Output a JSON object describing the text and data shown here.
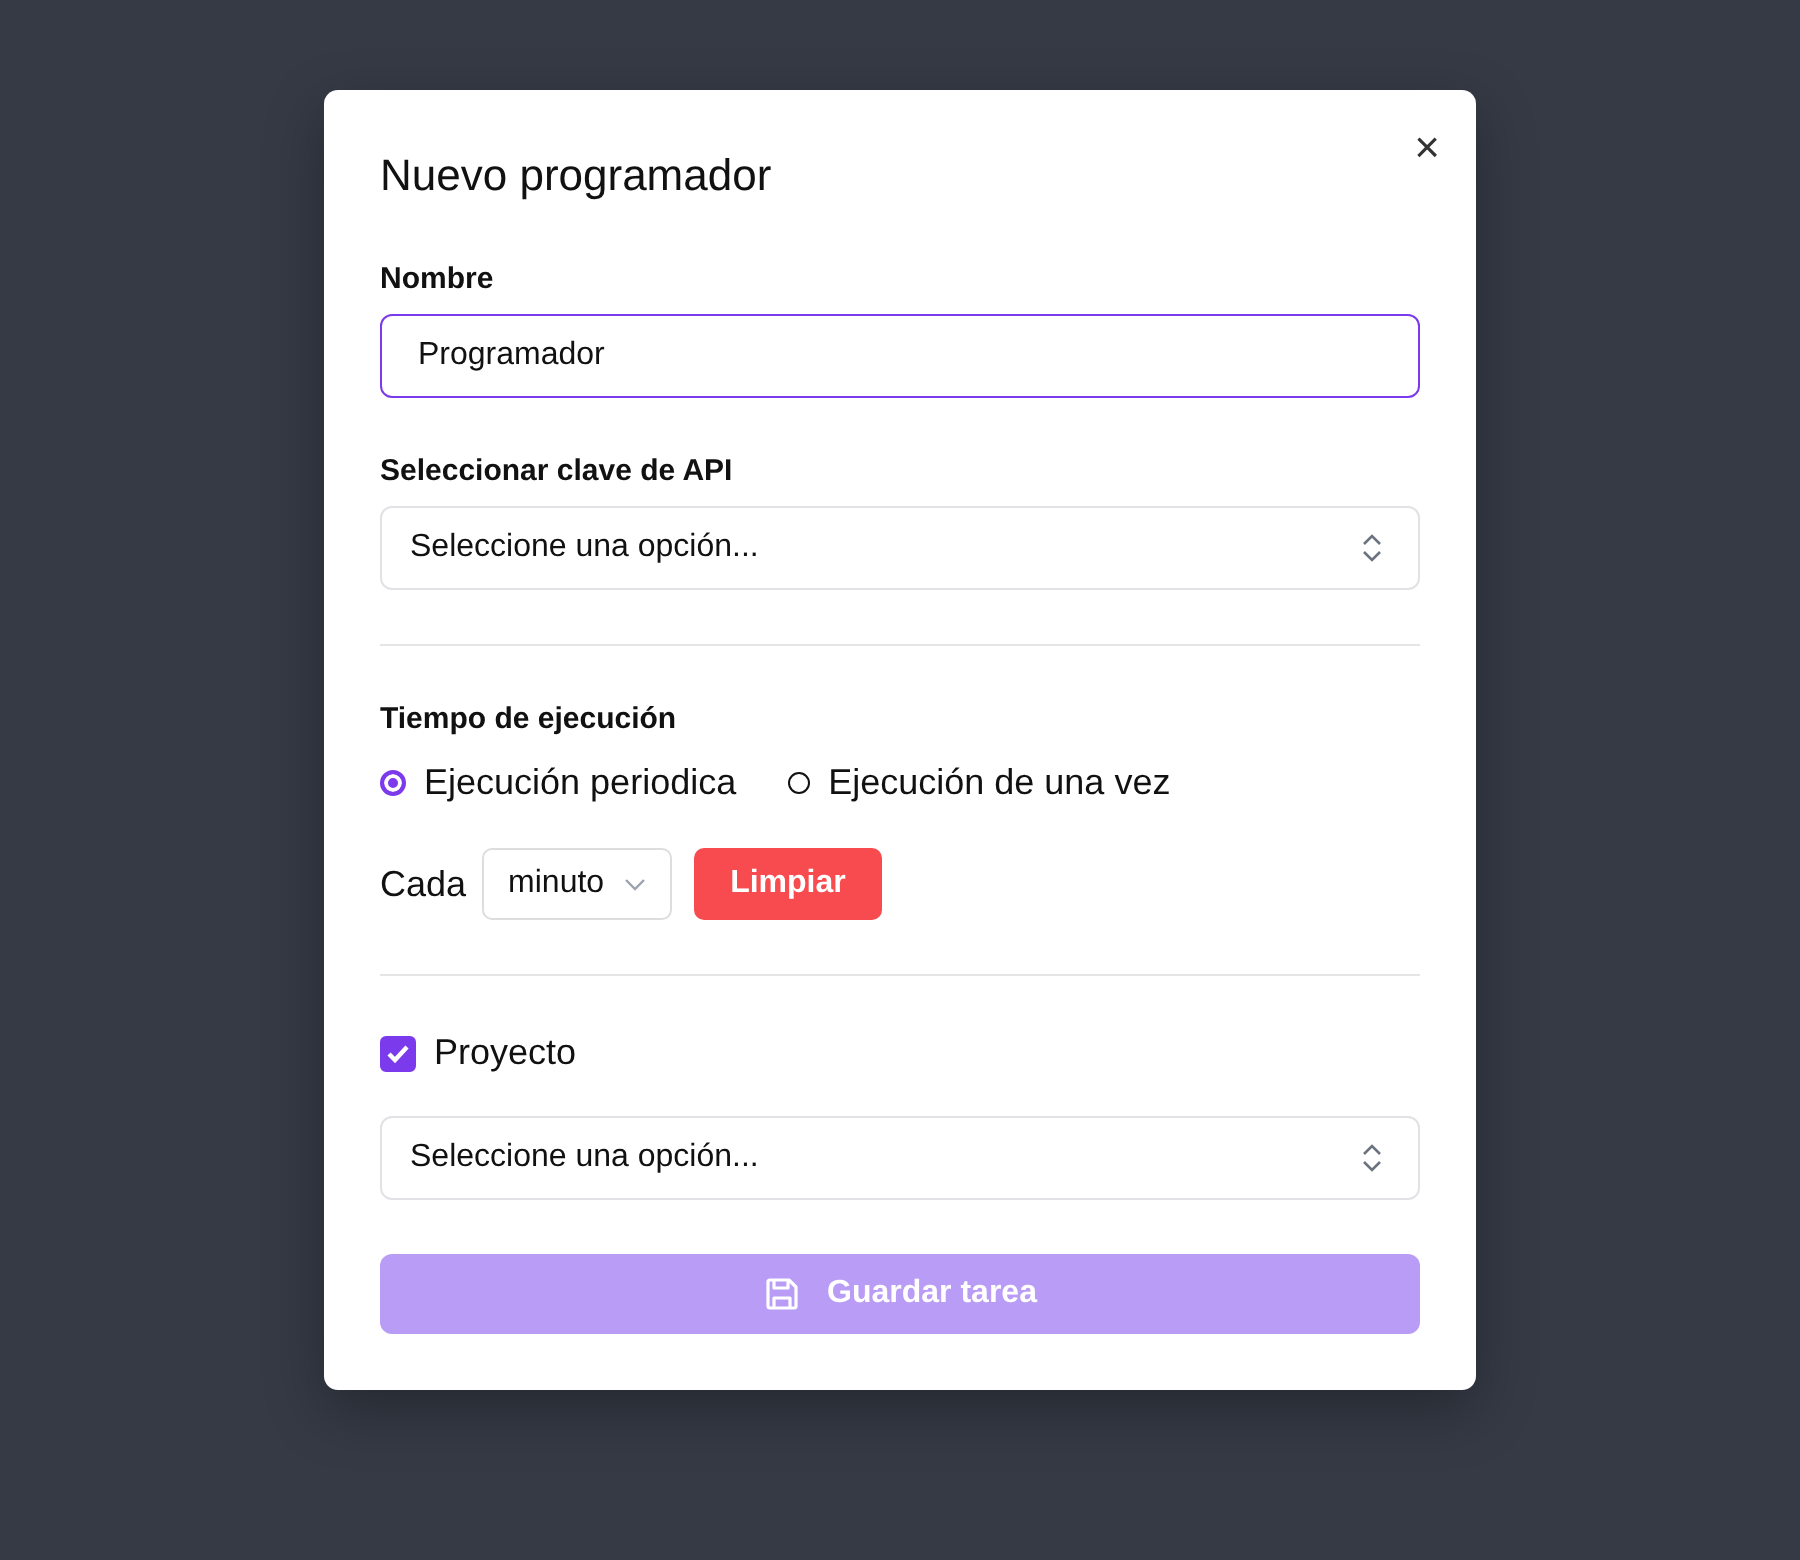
{
  "dialog": {
    "title": "Nuevo programador",
    "close": "×"
  },
  "name_field": {
    "label": "Nombre",
    "value": "Programador"
  },
  "api_key": {
    "label": "Seleccionar clave de API",
    "placeholder": "Seleccione una opción..."
  },
  "schedule": {
    "label": "Tiempo de ejecución",
    "modes": [
      {
        "label": "Ejecución periodica",
        "selected": true
      },
      {
        "label": "Ejecución de una vez",
        "selected": false
      }
    ],
    "every_label": "Cada",
    "unit": "minuto",
    "clear_button": "Limpiar"
  },
  "project": {
    "label": "Proyecto",
    "checked": true,
    "placeholder": "Seleccione una opción..."
  },
  "save_button": {
    "label": "Guardar tarea",
    "disabled": true
  }
}
